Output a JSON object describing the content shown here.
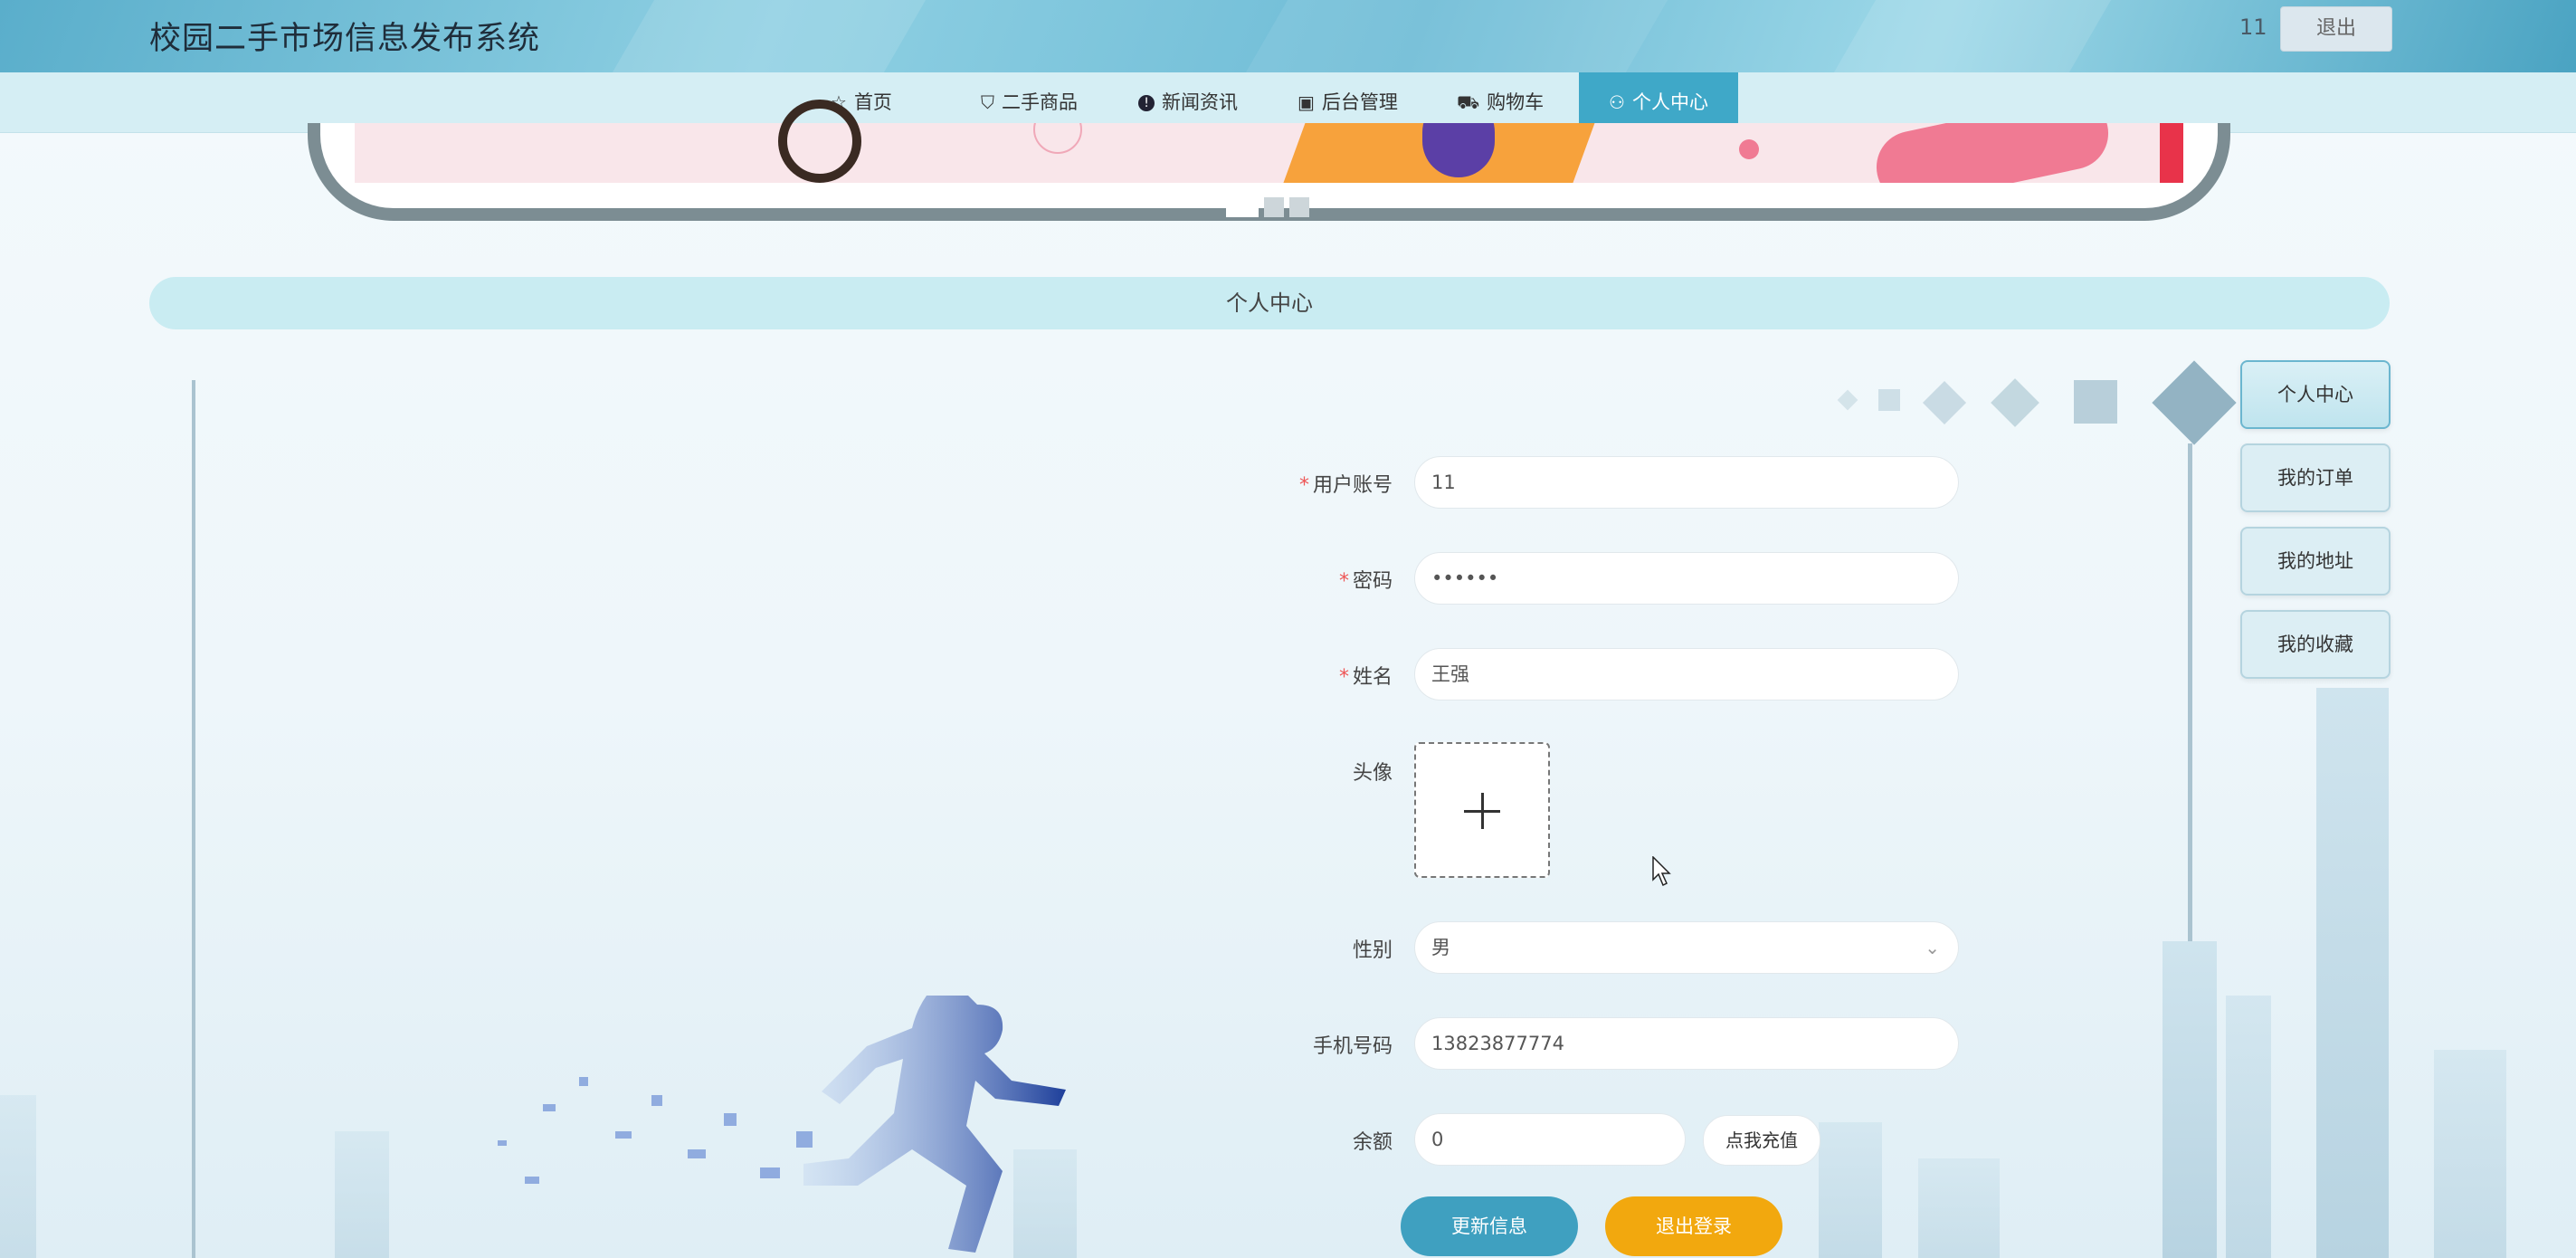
{
  "header": {
    "title": "校园二手市场信息发布系统",
    "user": "11",
    "logout_label": "退出"
  },
  "nav": {
    "items": [
      {
        "label": "首页",
        "icon": "star-icon"
      },
      {
        "label": "二手商品",
        "icon": "bag-icon"
      },
      {
        "label": "新闻资讯",
        "icon": "info-icon"
      },
      {
        "label": "后台管理",
        "icon": "clipboard-icon"
      },
      {
        "label": "购物车",
        "icon": "cart-icon"
      },
      {
        "label": "个人中心",
        "icon": "user-icon",
        "active": true
      }
    ]
  },
  "section": {
    "title": "个人中心"
  },
  "side_menu": {
    "items": [
      {
        "label": "个人中心",
        "active": true
      },
      {
        "label": "我的订单"
      },
      {
        "label": "我的地址"
      },
      {
        "label": "我的收藏"
      }
    ]
  },
  "form": {
    "account": {
      "label": "用户账号",
      "value": "11",
      "required": true
    },
    "password": {
      "label": "密码",
      "value": "••••••",
      "required": true
    },
    "name": {
      "label": "姓名",
      "value": "王强",
      "required": true
    },
    "avatar": {
      "label": "头像"
    },
    "gender": {
      "label": "性别",
      "value": "男"
    },
    "phone": {
      "label": "手机号码",
      "value": "13823877774"
    },
    "balance": {
      "label": "余额",
      "value": "0",
      "recharge_label": "点我充值"
    }
  },
  "actions": {
    "update_label": "更新信息",
    "logout_label": "退出登录"
  },
  "colors": {
    "accent": "#3fa8c8",
    "logout": "#f2a80e",
    "required": "#ee5555"
  }
}
